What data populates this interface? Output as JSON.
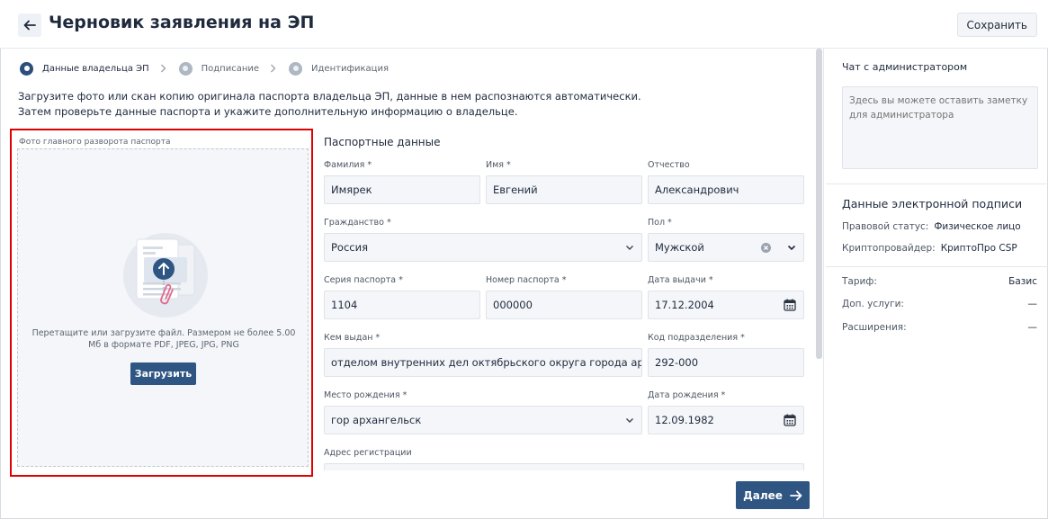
{
  "header": {
    "title": "Черновик заявления на ЭП",
    "save_label": "Сохранить"
  },
  "stepper": [
    {
      "label": "Данные владельца ЭП",
      "state": "active"
    },
    {
      "label": "Подписание",
      "state": "inactive"
    },
    {
      "label": "Идентификация",
      "state": "inactive"
    }
  ],
  "intro": {
    "line1": "Загрузите фото или скан копию оригинала паспорта владельца ЭП, данные в нем распознаются автоматически.",
    "line2": "Затем проверьте данные паспорта и укажите дополнительную информацию о владельце."
  },
  "upload": {
    "caption": "Фото главного разворота паспорта",
    "hint": "Перетащите или загрузите файл. Размером не более 5.00 Мб в формате PDF, JPEG, JPG, PNG",
    "button_label": "Загрузить"
  },
  "form": {
    "section_title": "Паспортные данные",
    "surname": {
      "label": "Фамилия *",
      "value": "Имярек"
    },
    "name": {
      "label": "Имя *",
      "value": "Евгений"
    },
    "patronymic": {
      "label": "Отчество",
      "value": "Александрович"
    },
    "citizenship": {
      "label": "Гражданство *",
      "value": "Россия"
    },
    "gender": {
      "label": "Пол *",
      "value": "Мужской"
    },
    "passport_series": {
      "label": "Серия паспорта *",
      "value": "1104"
    },
    "passport_number": {
      "label": "Номер паспорта *",
      "value": "000000"
    },
    "issue_date": {
      "label": "Дата выдачи *",
      "value": "17.12.2004"
    },
    "issued_by": {
      "label": "Кем выдан *",
      "value": "отделом внутренних дел октябрьского округа города архангельс"
    },
    "department_code": {
      "label": "Код подразделения *",
      "value": "292-000"
    },
    "birth_place": {
      "label": "Место рождения *",
      "value": "гор архангельск"
    },
    "birth_date": {
      "label": "Дата рождения *",
      "value": "12.09.1982"
    },
    "registration_address": {
      "label": "Адрес регистрации",
      "value": ""
    }
  },
  "next_label": "Далее",
  "chat": {
    "title": "Чат с администратором",
    "placeholder": "Здесь вы можете оставить заметку для администратора"
  },
  "signature": {
    "title": "Данные электронной подписи",
    "legal_status_label": "Правовой статус:",
    "legal_status_value": "Физическое лицо",
    "crypto_label": "Криптопровайдер:",
    "crypto_value": "КриптоПро CSP"
  },
  "tariff": {
    "tariff_label": "Тариф:",
    "tariff_value": "Базис",
    "services_label": "Доп. услуги:",
    "services_value": "—",
    "extensions_label": "Расширения:",
    "extensions_value": "—"
  },
  "colors": {
    "primary": "#2f5583",
    "highlight": "#e00000",
    "field_bg": "#f4f6f9"
  },
  "icons": [
    "arrow-left-icon",
    "chevron-right-icon",
    "upload-arrow-icon",
    "paperclip-icon",
    "chevron-down-icon",
    "clear-icon",
    "calendar-icon",
    "arrow-right-icon"
  ]
}
